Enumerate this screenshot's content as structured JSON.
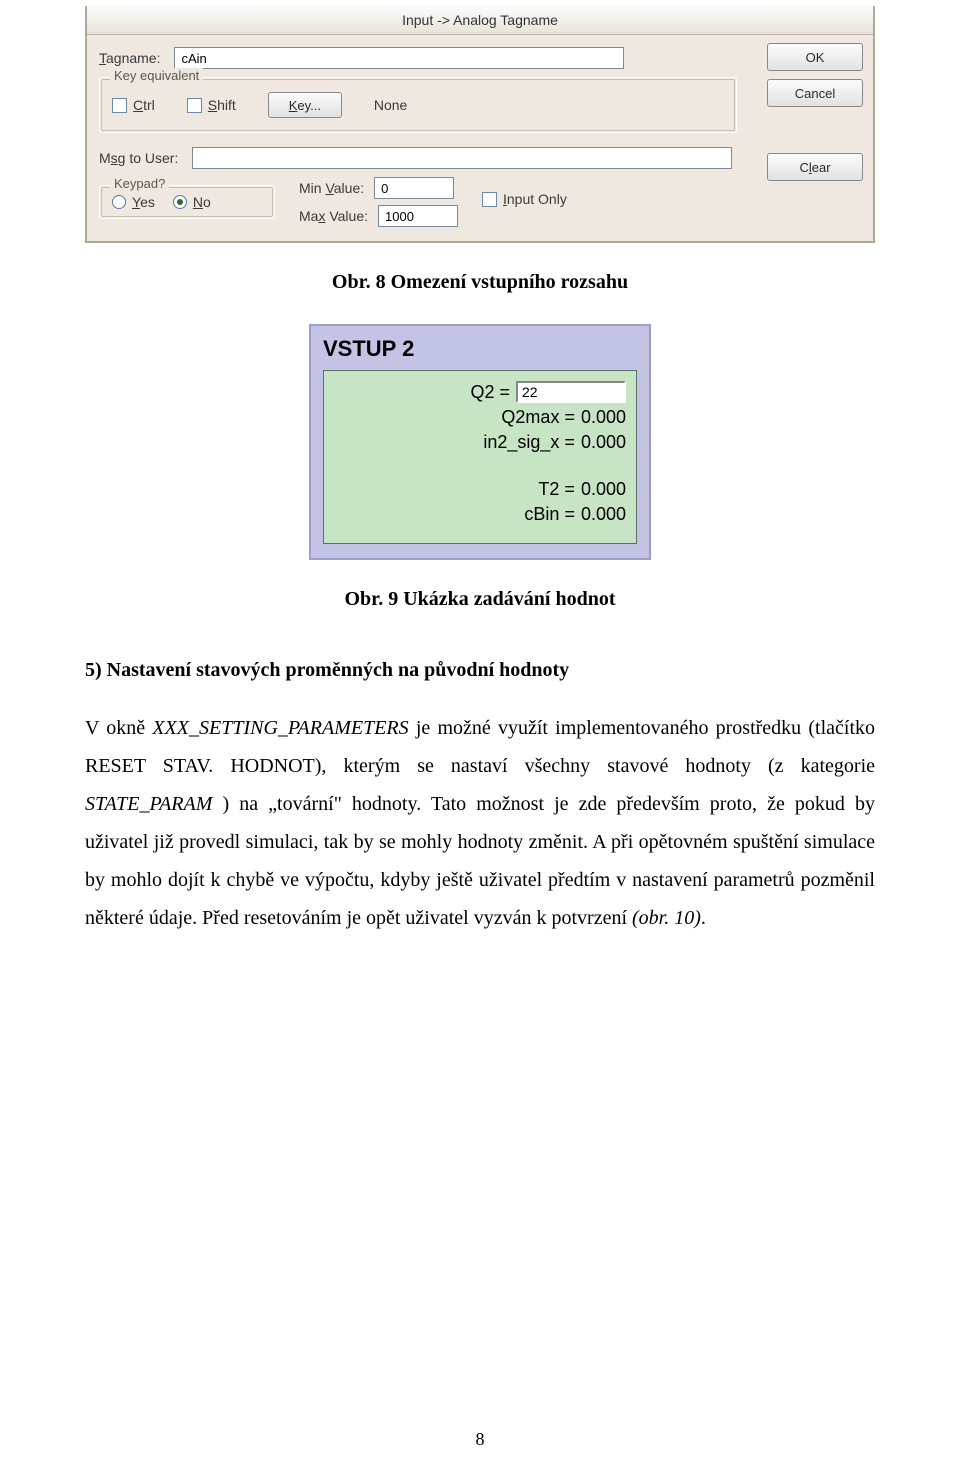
{
  "dialog": {
    "title": "Input -> Analog Tagname",
    "tagname_label": "Tagname:",
    "tagname_value": "cAin",
    "keyeq_legend": "Key equivalent",
    "ctrl_label": "Ctrl",
    "shift_label": "Shift",
    "key_button": "Key...",
    "key_value": "None",
    "msg_label": "Msg to User:",
    "msg_value": "",
    "keypad_legend": "Keypad?",
    "yes_label": "Yes",
    "no_label": "No",
    "minval_label": "Min Value:",
    "minval_value": "0",
    "maxval_label": "Max Value:",
    "maxval_value": "1000",
    "inputonly_label": "Input Only",
    "ok_label": "OK",
    "cancel_label": "Cancel",
    "clear_label": "Clear"
  },
  "caption1": "Obr. 8  Omezení vstupního rozsahu",
  "panel": {
    "title": "VSTUP 2",
    "q2_label": "Q2 =",
    "q2_value": "22",
    "lines": [
      {
        "lhs": "Q2max =",
        "rhs": "0.000"
      },
      {
        "lhs": "in2_sig_x =",
        "rhs": "0.000"
      },
      {
        "lhs": "T2 =",
        "rhs": "0.000"
      },
      {
        "lhs": "cBin =",
        "rhs": "0.000"
      }
    ]
  },
  "caption2": "Obr. 9  Ukázka zadávání hodnot",
  "body": {
    "heading": "5)  Nastavení stavových proměnných na původní hodnoty",
    "p1a": "V okně ",
    "p1b": "XXX_SETTING_PARAMETERS",
    "p1c": "  je možné využít implementovaného prostředku (tlačítko RESET STAV. HODNOT), kterým se nastaví všechny stavové hodnoty (z kategorie ",
    "p1d": "STATE_PARAM ",
    "p1e": ") na „tovární\" hodnoty. Tato možnost je zde především proto, že pokud by uživatel již provedl simulaci, tak by se mohly hodnoty změnit. A při opětovném spuštění simulace by mohlo dojít k chybě ve výpočtu, kdyby ještě uživatel předtím v nastavení parametrů pozměnil některé údaje. Před resetováním je opět uživatel vyzván k potvrzení ",
    "p1f": "(obr. 10)",
    "p1g": "."
  },
  "pagenum": "8"
}
